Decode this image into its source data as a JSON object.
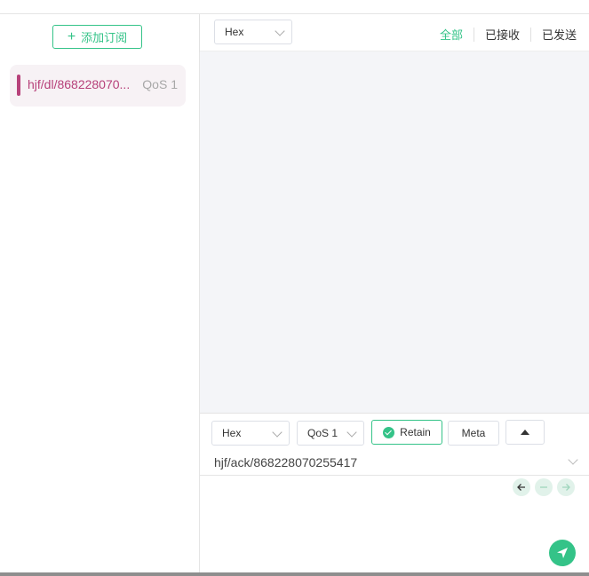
{
  "sidebar": {
    "add_subscription_label": "添加订阅",
    "subscriptions": [
      {
        "topic": "hjf/dl/868228070...",
        "qos": "QoS 1",
        "color": "#b7417a"
      }
    ]
  },
  "messages": {
    "format_selected": "Hex",
    "filters": {
      "all": "全部",
      "received": "已接收",
      "sent": "已发送",
      "active": "all"
    }
  },
  "publish": {
    "format_selected": "Hex",
    "qos_selected": "QoS 1",
    "retain_label": "Retain",
    "retain_checked": true,
    "meta_label": "Meta",
    "topic_value": "hjf/ack/868228070255417",
    "payload_value": ""
  },
  "colors": {
    "accent": "#34c388",
    "topic_color": "#b7417a",
    "message_area_bg": "#f4f5f8"
  },
  "icons": [
    "plus-icon",
    "chevron-down-icon",
    "check-circle-icon",
    "caret-up-icon",
    "arrow-left-icon",
    "minus-icon",
    "arrow-right-icon",
    "send-icon"
  ]
}
